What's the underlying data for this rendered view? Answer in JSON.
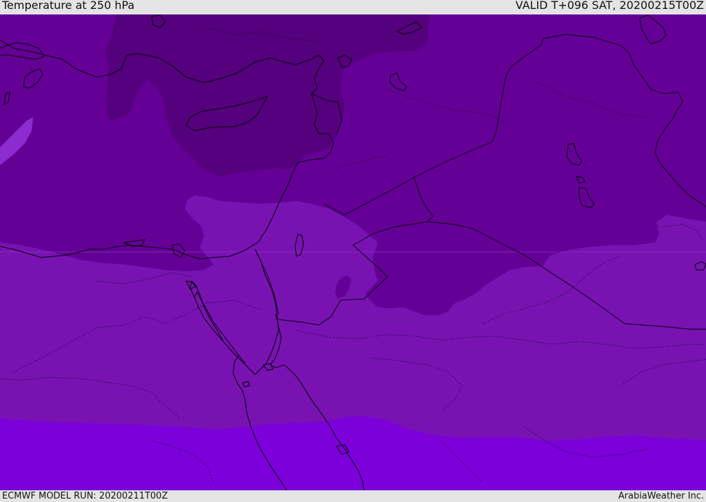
{
  "header": {
    "title": "Temperature at 250 hPa",
    "valid": "VALID T+096 SAT, 20200215T00Z"
  },
  "footer": {
    "model_run": "ECMWF MODEL RUN: 20200211T00Z",
    "credit": "ArabiaWeather Inc."
  },
  "colors": {
    "band_coldest": "#55007d",
    "band_cold": "#650096",
    "band_mid": "#7813b2",
    "band_warm": "#7b00da",
    "band_pale": "#8c2bd0",
    "coastline": "#000000"
  }
}
